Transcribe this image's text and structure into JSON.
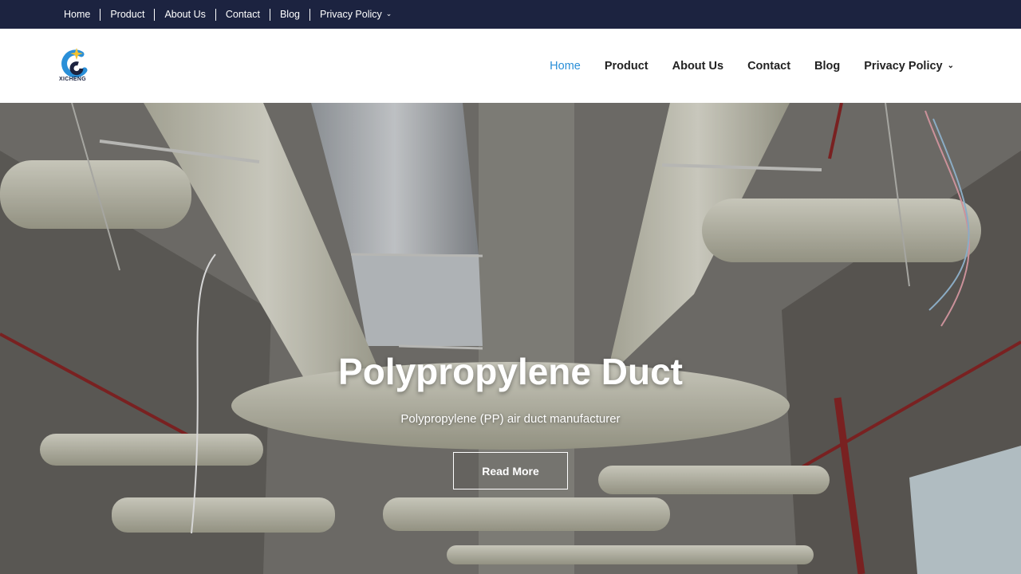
{
  "topnav": {
    "items": [
      "Home",
      "Product",
      "About Us",
      "Contact",
      "Blog",
      "Privacy Policy"
    ]
  },
  "brand": {
    "name": "XICHENG",
    "primary_color": "#1c2340",
    "accent_color": "#2a8fd8",
    "star_color": "#f2c230"
  },
  "mainnav": {
    "items": [
      "Home",
      "Product",
      "About Us",
      "Contact",
      "Blog",
      "Privacy Policy"
    ],
    "active": "Home"
  },
  "hero": {
    "title": "Polypropylene Duct",
    "subtitle": "Polypropylene (PP) air duct manufacturer",
    "button": "Read More"
  },
  "icons": {
    "dropdown": "chevron-down-icon",
    "logo": "xicheng-logo"
  }
}
